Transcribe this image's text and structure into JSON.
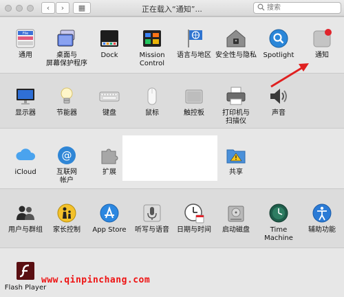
{
  "window": {
    "title": "正在载入“通知”...",
    "search_placeholder": "搜索",
    "grid_glyph": "▦"
  },
  "rows": [
    {
      "items": [
        {
          "label": "通用",
          "icon": "general-icon"
        },
        {
          "label": "桌面与\n屏幕保护程序",
          "icon": "desktop-screensaver-icon"
        },
        {
          "label": "Dock",
          "icon": "dock-icon"
        },
        {
          "label": "Mission\nControl",
          "icon": "mission-control-icon"
        },
        {
          "label": "语言与地区",
          "icon": "language-region-icon"
        },
        {
          "label": "安全性与隐私",
          "icon": "security-privacy-icon"
        },
        {
          "label": "Spotlight",
          "icon": "spotlight-icon"
        },
        {
          "label": "通知",
          "icon": "notifications-icon"
        }
      ]
    },
    {
      "items": [
        {
          "label": "显示器",
          "icon": "displays-icon"
        },
        {
          "label": "节能器",
          "icon": "energy-saver-icon"
        },
        {
          "label": "键盘",
          "icon": "keyboard-icon"
        },
        {
          "label": "鼠标",
          "icon": "mouse-icon"
        },
        {
          "label": "触控板",
          "icon": "trackpad-icon"
        },
        {
          "label": "打印机与\n扫描仪",
          "icon": "printers-scanners-icon"
        },
        {
          "label": "声音",
          "icon": "sound-icon"
        }
      ]
    },
    {
      "items": [
        {
          "label": "iCloud",
          "icon": "icloud-icon"
        },
        {
          "label": "互联网\n帐户",
          "icon": "internet-accounts-icon"
        },
        {
          "label": "扩展",
          "icon": "extensions-icon"
        },
        {
          "label": "共享",
          "icon": "sharing-icon"
        }
      ]
    },
    {
      "items": [
        {
          "label": "用户与群组",
          "icon": "users-groups-icon"
        },
        {
          "label": "家长控制",
          "icon": "parental-controls-icon"
        },
        {
          "label": "App Store",
          "icon": "app-store-icon"
        },
        {
          "label": "听写与语音",
          "icon": "dictation-speech-icon"
        },
        {
          "label": "日期与时间",
          "icon": "date-time-icon"
        },
        {
          "label": "启动磁盘",
          "icon": "startup-disk-icon"
        },
        {
          "label": "Time Machine",
          "icon": "time-machine-icon"
        },
        {
          "label": "辅助功能",
          "icon": "accessibility-icon"
        }
      ]
    },
    {
      "items": [
        {
          "label": "Flash Player",
          "icon": "flash-player-icon"
        }
      ]
    }
  ],
  "watermark": "www.qinpinchang.com"
}
